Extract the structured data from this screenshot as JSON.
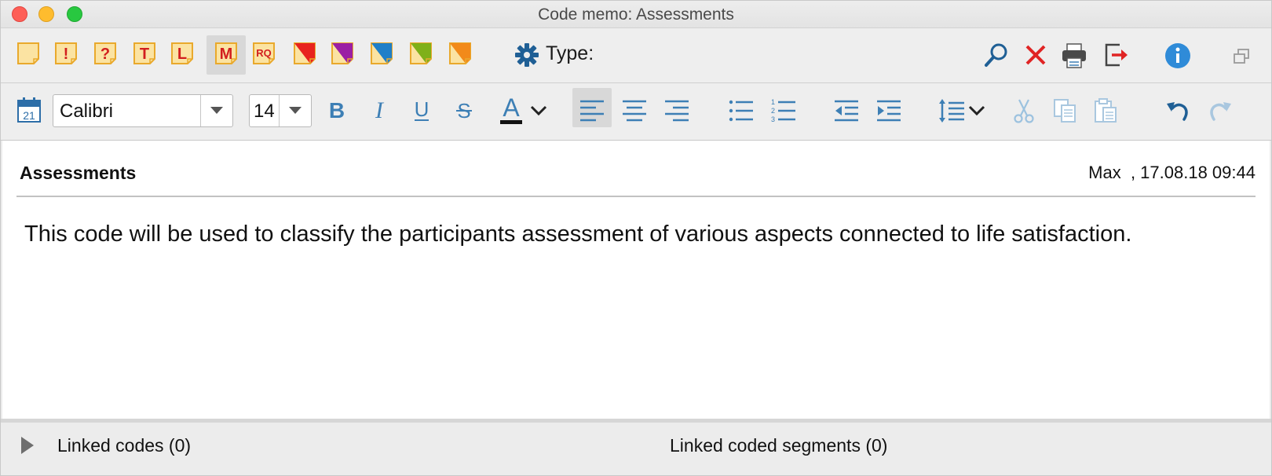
{
  "window": {
    "title": "Code memo: Assessments"
  },
  "toolbar": {
    "memo_types": [
      {
        "name": "memo-plain-icon",
        "letter": "",
        "flag": ""
      },
      {
        "name": "memo-exclamation-icon",
        "letter": "!",
        "flag": ""
      },
      {
        "name": "memo-question-icon",
        "letter": "?",
        "flag": ""
      },
      {
        "name": "memo-t-icon",
        "letter": "T",
        "flag": ""
      },
      {
        "name": "memo-l-icon",
        "letter": "L",
        "flag": ""
      },
      {
        "name": "memo-m-icon",
        "letter": "M",
        "flag": "",
        "selected": true
      },
      {
        "name": "memo-rq-icon",
        "letter": "RQ",
        "flag": ""
      },
      {
        "name": "memo-red-flag-icon",
        "letter": "",
        "flag": "#e8231e"
      },
      {
        "name": "memo-purple-flag-icon",
        "letter": "",
        "flag": "#9b1fa4"
      },
      {
        "name": "memo-blue-flag-icon",
        "letter": "",
        "flag": "#1f7fc8"
      },
      {
        "name": "memo-green-flag-icon",
        "letter": "",
        "flag": "#7fb019"
      },
      {
        "name": "memo-orange-flag-icon",
        "letter": "",
        "flag": "#f28a1a"
      }
    ],
    "type_label": "Type:"
  },
  "format": {
    "font_family": "Calibri",
    "font_size": "14"
  },
  "memo": {
    "title": "Assessments",
    "meta": "Max  , 17.08.18 09:44",
    "text": "This code will be used to classify the participants assessment of various aspects connected to life satisfaction."
  },
  "footer": {
    "linked_codes": "Linked codes (0)",
    "linked_segments": "Linked coded segments (0)"
  },
  "colors": {
    "memo_fill": "#fbe3a2",
    "memo_border": "#e9a92c",
    "memo_letter": "#d21e1e",
    "icon_blue": "#3d7fb5",
    "icon_blue_dark": "#1f5f95",
    "close_red": "#e02424"
  }
}
